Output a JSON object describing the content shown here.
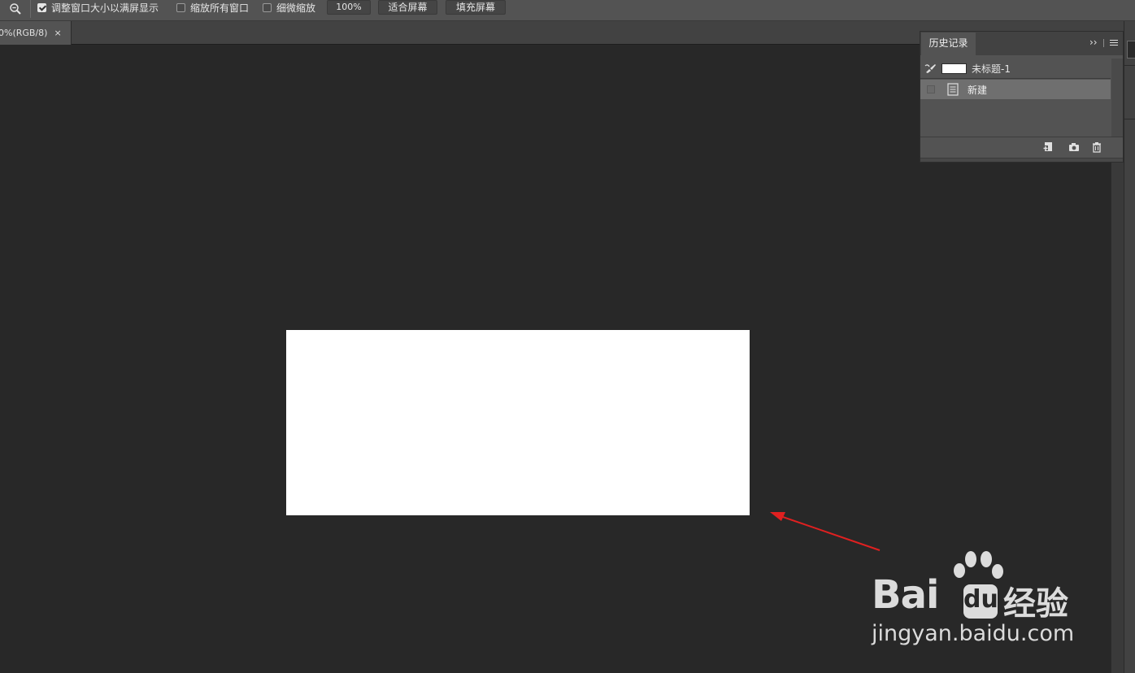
{
  "options_bar": {
    "zoom_tool_icon": "zoom-out-magnifier-icon",
    "resize_windows_label": "调整窗口大小以满屏显示",
    "resize_windows_checked": true,
    "zoom_all_windows_label": "缩放所有窗口",
    "zoom_all_windows_checked": false,
    "scrubby_zoom_label": "细微缩放",
    "scrubby_zoom_checked": false,
    "zoom_percent": "100%",
    "fit_screen_label": "适合屏幕",
    "fill_screen_label": "填充屏幕"
  },
  "document_tab": {
    "title": "0%(RGB/8)",
    "close_glyph": "×"
  },
  "history_panel": {
    "tab_label": "历史记录",
    "expand_glyph": "››",
    "snapshot_name": "未标题-1",
    "states": [
      {
        "label": "新建",
        "selected": true
      }
    ],
    "footer_icons": [
      "new-document-from-state-icon",
      "camera-snapshot-icon",
      "trash-delete-icon"
    ]
  },
  "watermark": {
    "brand": "Bai",
    "brand_du": "du",
    "brand_cn": "经验",
    "url": "jingyan.baidu.com"
  },
  "colors": {
    "canvas_bg": "#282828",
    "artboard": "#ffffff",
    "panel_bg": "#535353",
    "selected_row": "#6f6f6f",
    "annotation_arrow": "#e02020"
  }
}
